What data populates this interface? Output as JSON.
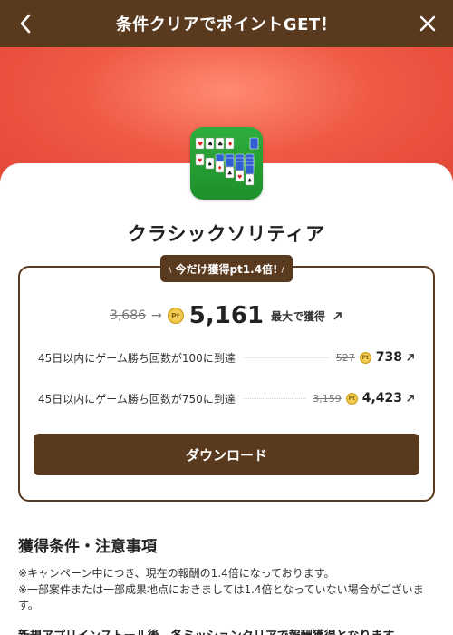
{
  "header": {
    "title": "条件クリアでポイントGET！",
    "back_icon": "chevron-left-icon",
    "close_icon": "close-icon",
    "background_color": "#5a3a1f"
  },
  "hero": {
    "gradient_colors": [
      "#ff8a72",
      "#ef5a45",
      "#e24636"
    ]
  },
  "app": {
    "name": "クラシックソリティア",
    "icon": "solitaire-app-icon"
  },
  "promo": {
    "badge": "今だけ獲得pt1.4倍!",
    "total_old": "3,686",
    "total_new": "5,161",
    "total_suffix": "最大で獲得",
    "pt_label": "Pt"
  },
  "conditions": [
    {
      "text": "45日以内にゲーム勝ち回数が100に到達",
      "old": "527",
      "new": "738"
    },
    {
      "text": "45日以内にゲーム勝ち回数が750に到達",
      "old": "3,159",
      "new": "4,423"
    }
  ],
  "download_button": "ダウンロード",
  "terms": {
    "title": "獲得条件・注意事項",
    "notes": [
      "※キャンペーン中につき、現在の報酬の1.4倍になっております。",
      "※一部案件または一部成果地点におきましては1.4倍となっていない場合がございま",
      "す。"
    ],
    "next_line": "新規アプリインストール後、各ミッションクリアで報酬獲得となります。"
  },
  "colors": {
    "brand_brown": "#5a3a1f",
    "coin_gold": "#e3b526",
    "app_green": "#1e8f2b"
  }
}
